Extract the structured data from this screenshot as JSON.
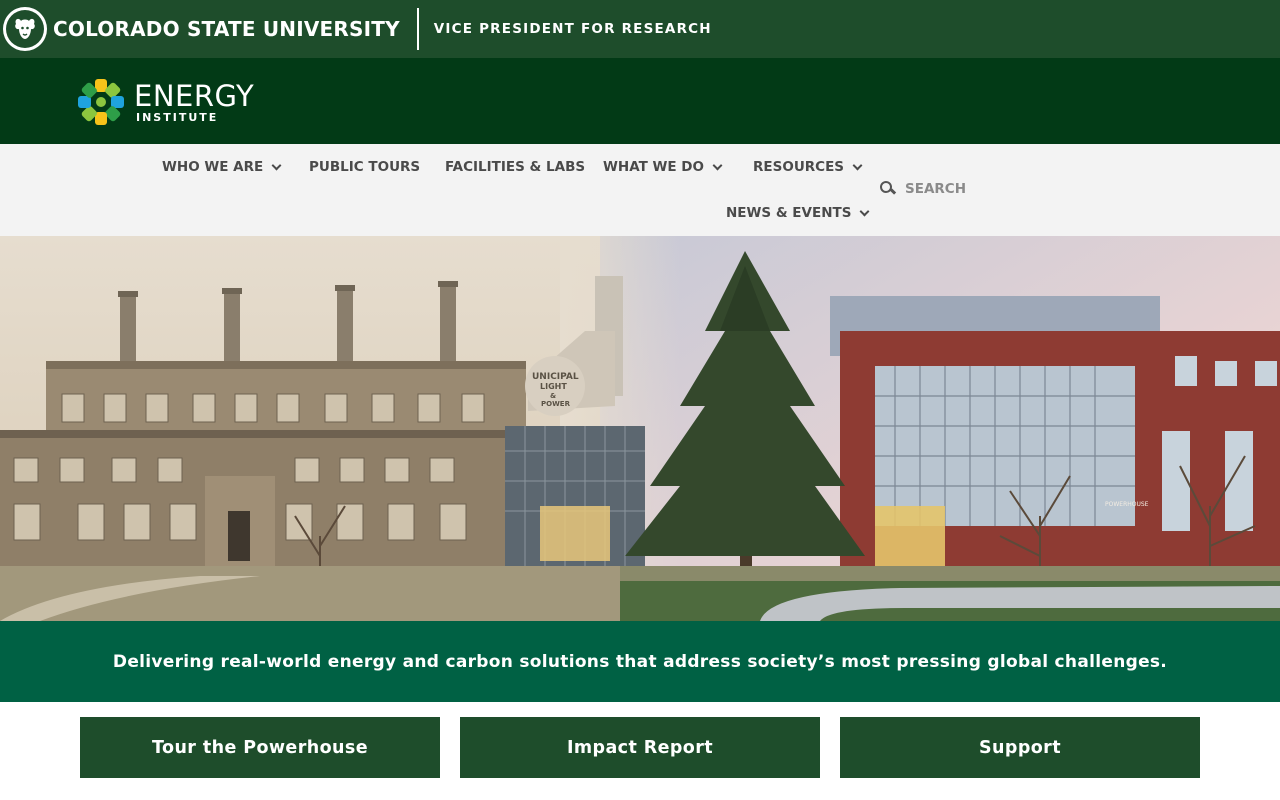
{
  "csu_header": {
    "university_name": "COLORADO STATE UNIVERSITY",
    "unit_name": "VICE PRESIDENT FOR RESEARCH",
    "logo_icon": "csu-ram-logo-icon"
  },
  "brand": {
    "name_line1": "ENERGY",
    "name_line2": "INSTITUTE",
    "logo_icon": "energy-institute-flower-icon"
  },
  "nav": {
    "items": [
      {
        "label": "WHO WE ARE",
        "has_dropdown": true
      },
      {
        "label": "PUBLIC TOURS",
        "has_dropdown": false
      },
      {
        "label": "FACILITIES & LABS",
        "has_dropdown": false
      },
      {
        "label": "WHAT WE DO",
        "has_dropdown": true
      },
      {
        "label": "RESOURCES",
        "has_dropdown": true
      },
      {
        "label": "NEWS & EVENTS",
        "has_dropdown": true
      }
    ],
    "search_placeholder": "SEARCH"
  },
  "hero": {
    "signage_line1": "UNICIPAL",
    "signage_line2": "LIGHT",
    "signage_line3": "&",
    "signage_line4": "POWER",
    "building_sign": "POWERHOUSE"
  },
  "tagline": "Delivering real-world energy and carbon solutions that address society’s most pressing global challenges.",
  "cta": [
    {
      "label": "Tour the Powerhouse"
    },
    {
      "label": "Impact Report"
    },
    {
      "label": "Support"
    }
  ],
  "colors": {
    "csu_green": "#1e4d2b",
    "dark_green": "#023a16",
    "tagline_green": "#006144",
    "nav_bg": "#f3f3f3"
  }
}
